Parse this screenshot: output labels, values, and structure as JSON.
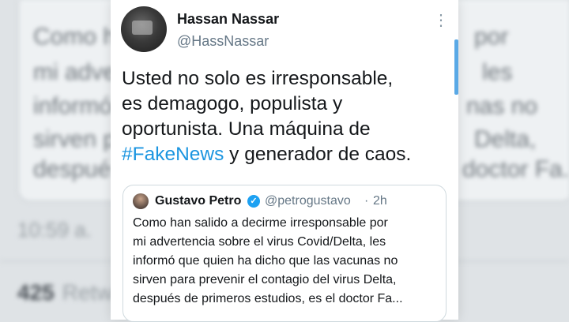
{
  "background": {
    "lines": [
      "Como h",
      "mi adve",
      "informó",
      "sirven p",
      "despué"
    ],
    "right_lines": [
      "por",
      "les",
      "nas no",
      "Delta,",
      "doctor Fa..."
    ],
    "time_text": "10:59 a.",
    "retweet_count": "425",
    "retweet_label": "Retw"
  },
  "tweet": {
    "author_name": "Hassan Nassar",
    "author_handle": "@HassNassar",
    "text_lines": [
      "Usted no solo es irresponsable,",
      "es demagogo, populista y",
      "oportunista. Una máquina de"
    ],
    "hashtag": "#FakeNews",
    "text_tail": " y generador de caos."
  },
  "quoted_tweet": {
    "author_name": "Gustavo Petro",
    "author_handle": "@petrogustavo",
    "separator": "·",
    "time": "2h",
    "text_lines": [
      "Como han salido a decirme irresponsable por",
      "mi advertencia sobre el virus Covid/Delta, les",
      "informó que quien ha dicho que las vacunas no",
      "sirven para prevenir el contagio del virus Delta,",
      "después de primeros estudios, es el doctor Fa..."
    ]
  },
  "colors": {
    "hashtag": "#1b95e0",
    "verified": "#1da1f2",
    "secondary_text": "#657786"
  },
  "icons": [
    "more-vertical-icon",
    "verified-badge-icon"
  ]
}
